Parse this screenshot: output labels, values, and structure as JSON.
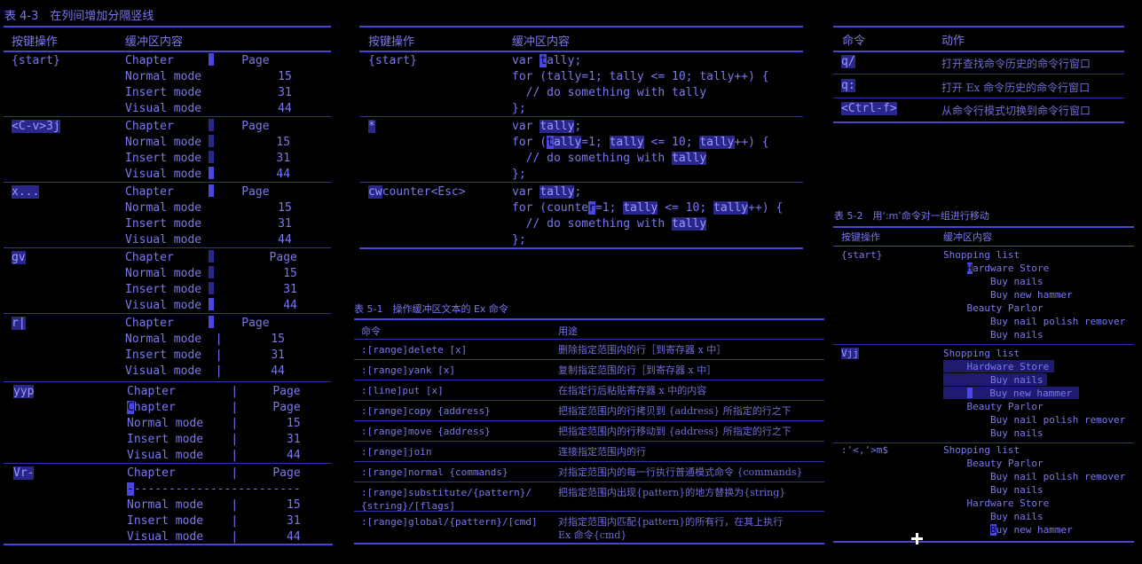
{
  "t43": {
    "caption": "表 4-3　在列间增加分隔竖线",
    "h1": "按键操作",
    "h2": "缓冲区内容",
    "rows": [
      {
        "key": "{start}",
        "buf": "Chapter        Page\nNormal mode      15\nInsert mode      31\nVisual mode      44"
      },
      {
        "key": "<C-v>3j",
        "buf": "Chapter        Page\nNormal mode      15\nInsert mode      31\nVisual mode      44"
      },
      {
        "key": "x...",
        "buf": "Chapter     Page\nNormal mode   15\nInsert mode   31\nVisual mode   44"
      },
      {
        "key": "gv",
        "buf": "Chapter     Page\nNormal mode   15\nInsert mode   31\nVisual mode   44"
      },
      {
        "key": "r|",
        "buf": "Chapter    | Page\nNormal mode |   15\nInsert mode |   31\nVisual mode |   44"
      },
      {
        "key": "yyp",
        "buf": "Chapter    |  Page\nChapter    |  Page\nNormal mode   |   15\nInsert mode   |   31\nVisual mode   |   44"
      },
      {
        "key": "Vr-",
        "buf": "Chapter    |  Page\n-------------------------\nNormal mode   |   15\nInsert mode   |   31\nVisual mode   |   44"
      }
    ]
  },
  "mid": {
    "h1": "按键操作",
    "h2": "缓冲区内容",
    "rows": [
      {
        "key": "{start}",
        "buf": "var tally;\nfor (tally=1; tally <= 10; tally++) {\n  // do something with tally\n};"
      },
      {
        "key": "*",
        "buf": "var tally;\nfor (tally=1; tally <= 10; tally++) {\n  // do something with tally\n};"
      },
      {
        "key": "cwcounter<Esc>",
        "buf": "var tally;\nfor (counter=1; tally <= 10; tally++) {\n  // do something with tally\n};"
      }
    ]
  },
  "t51": {
    "caption": "表 5-1　操作缓冲区文本的 Ex 命令",
    "h1": "命令",
    "h2": "用途",
    "rows": [
      {
        "cmd": ":[range]delete [x]",
        "desc": "删除指定范围内的行［到寄存器 x 中］"
      },
      {
        "cmd": ":[range]yank [x]",
        "desc": "复制指定范围的行［到寄存器 x 中］"
      },
      {
        "cmd": ":[line]put [x]",
        "desc": "在指定行后粘贴寄存器 x 中的内容"
      },
      {
        "cmd": ":[range]copy {address}",
        "desc": "把指定范围内的行拷贝到 {address} 所指定的行之下"
      },
      {
        "cmd": ":[range]move {address}",
        "desc": "把指定范围内的行移动到 {address} 所指定的行之下"
      },
      {
        "cmd": ":[range]join",
        "desc": "连接指定范围内的行"
      },
      {
        "cmd": ":[range]normal {commands}",
        "desc": "对指定范围内的每一行执行普通模式命令 {commands}"
      },
      {
        "cmd": ":[range]substitute/{pattern}/\n{string}/[flags]",
        "desc": "把指定范围内出现{pattern}的地方替换为{string}"
      },
      {
        "cmd": ":[range]global/{pattern}/[cmd]",
        "desc": "对指定范围内匹配{pattern}的所有行，在其上执行\nEx 命令{cmd}"
      }
    ]
  },
  "tr": {
    "h1": "命令",
    "h2": "动作",
    "rows": [
      {
        "cmd": "q/",
        "desc": "打开查找命令历史的命令行窗口"
      },
      {
        "cmd": "q:",
        "desc": "打开 Ex 命令历史的命令行窗口"
      },
      {
        "cmd": "<Ctrl-f>",
        "desc": "从命令行模式切换到命令行窗口"
      }
    ]
  },
  "t52": {
    "caption": "表 5-2　用‘:m’命令对一组进行移动",
    "h1": "按键操作",
    "h2": "缓冲区内容",
    "rows": [
      {
        "key": "{start}",
        "buf": "Shopping list\n    Hardware Store\n        Buy nails\n        Buy new hammer\n    Beauty Parlor\n        Buy nail polish remover\n        Buy nails"
      },
      {
        "key": "Vjj",
        "buf": "Shopping list\n    Hardware Store\n        Buy nails\n        Buy new hammer\n    Beauty Parlor\n        Buy nail polish remover\n        Buy nails"
      },
      {
        "key": ":'<,'>m$",
        "buf": "Shopping list\n    Beauty Parlor\n        Buy nail polish remover\n        Buy nails\n    Hardware Store\n        Buy nails\n        Buy new hammer"
      }
    ]
  }
}
